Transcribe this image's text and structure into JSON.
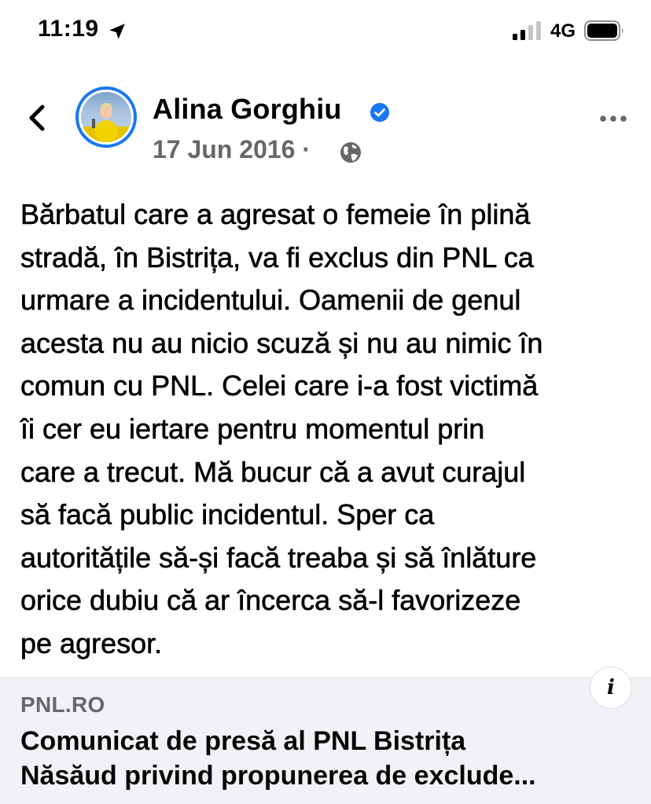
{
  "status_bar": {
    "time": "11:19",
    "network": "4G",
    "icons": [
      "location-arrow-icon",
      "signal-icon",
      "battery-icon"
    ]
  },
  "post": {
    "author": "Alina Gorghiu",
    "date": "17 Jun 2016 ·",
    "visibility_icon": "globe-icon",
    "verified_icon": "verified-badge-icon",
    "text": "Bărbatul care a agresat o femeie în plină\nstradă, în Bistrița, va fi exclus din PNL ca\nurmare a incidentului. Oamenii de genul\nacesta nu au nicio scuză și nu au nimic în\ncomun cu PNL. Celei care i-a fost victimă\nîi cer eu iertare pentru momentul prin\ncare a trecut. Mă bucur că a avut curajul\nsă facă public incidentul. Sper ca\nautoritățile să-și facă treaba și să înlăture\norice dubiu că ar încerca să-l favorizeze\npe agresor."
  },
  "link_preview": {
    "domain": "PNL.RO",
    "title": "Comunicat de presă al PNL Bistrița\nNăsăud privind propunerea de exclude...",
    "info_label": "i"
  },
  "colors": {
    "accent": "#1877f2",
    "secondary_text": "#65676b",
    "card_bg": "#f0f2f5"
  }
}
